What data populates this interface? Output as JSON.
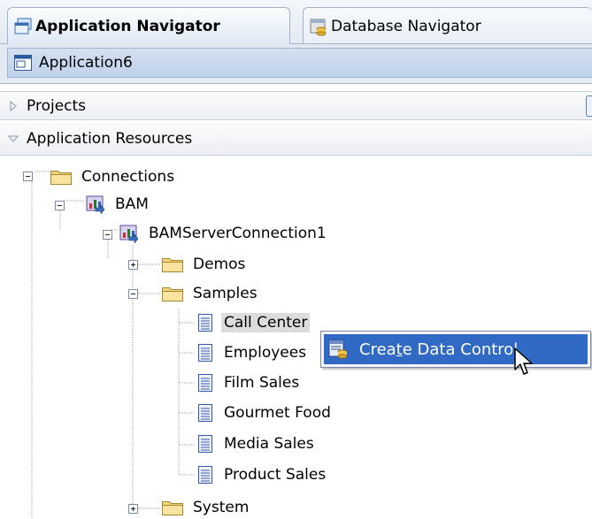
{
  "tabs": [
    {
      "label": "Application Navigator",
      "icon": "application-navigator-icon",
      "active": true
    },
    {
      "label": "Database Navigator",
      "icon": "database-navigator-icon",
      "active": false
    }
  ],
  "app_selector": {
    "label": "Application6",
    "icon": "application-icon"
  },
  "accordions": {
    "projects": {
      "label": "Projects",
      "expanded": false
    },
    "resources": {
      "label": "Application Resources",
      "expanded": true
    }
  },
  "tree": {
    "connections": "Connections",
    "bam": "BAM",
    "server": "BAMServerConnection1",
    "demos": "Demos",
    "samples": "Samples",
    "reports": [
      "Call Center",
      "Employees",
      "Film Sales",
      "Gourmet Food",
      "Media Sales",
      "Product Sales"
    ],
    "system": "System"
  },
  "context_menu": {
    "item": "Create Data Control",
    "mnemonic": "t",
    "icon": "data-control-icon"
  },
  "colors": {
    "selection_blue": "#316AC5",
    "folder_yellow": "#F2D57A",
    "tab_border": "#9FB4CF",
    "selected_row_gray": "#DCDCDC"
  }
}
